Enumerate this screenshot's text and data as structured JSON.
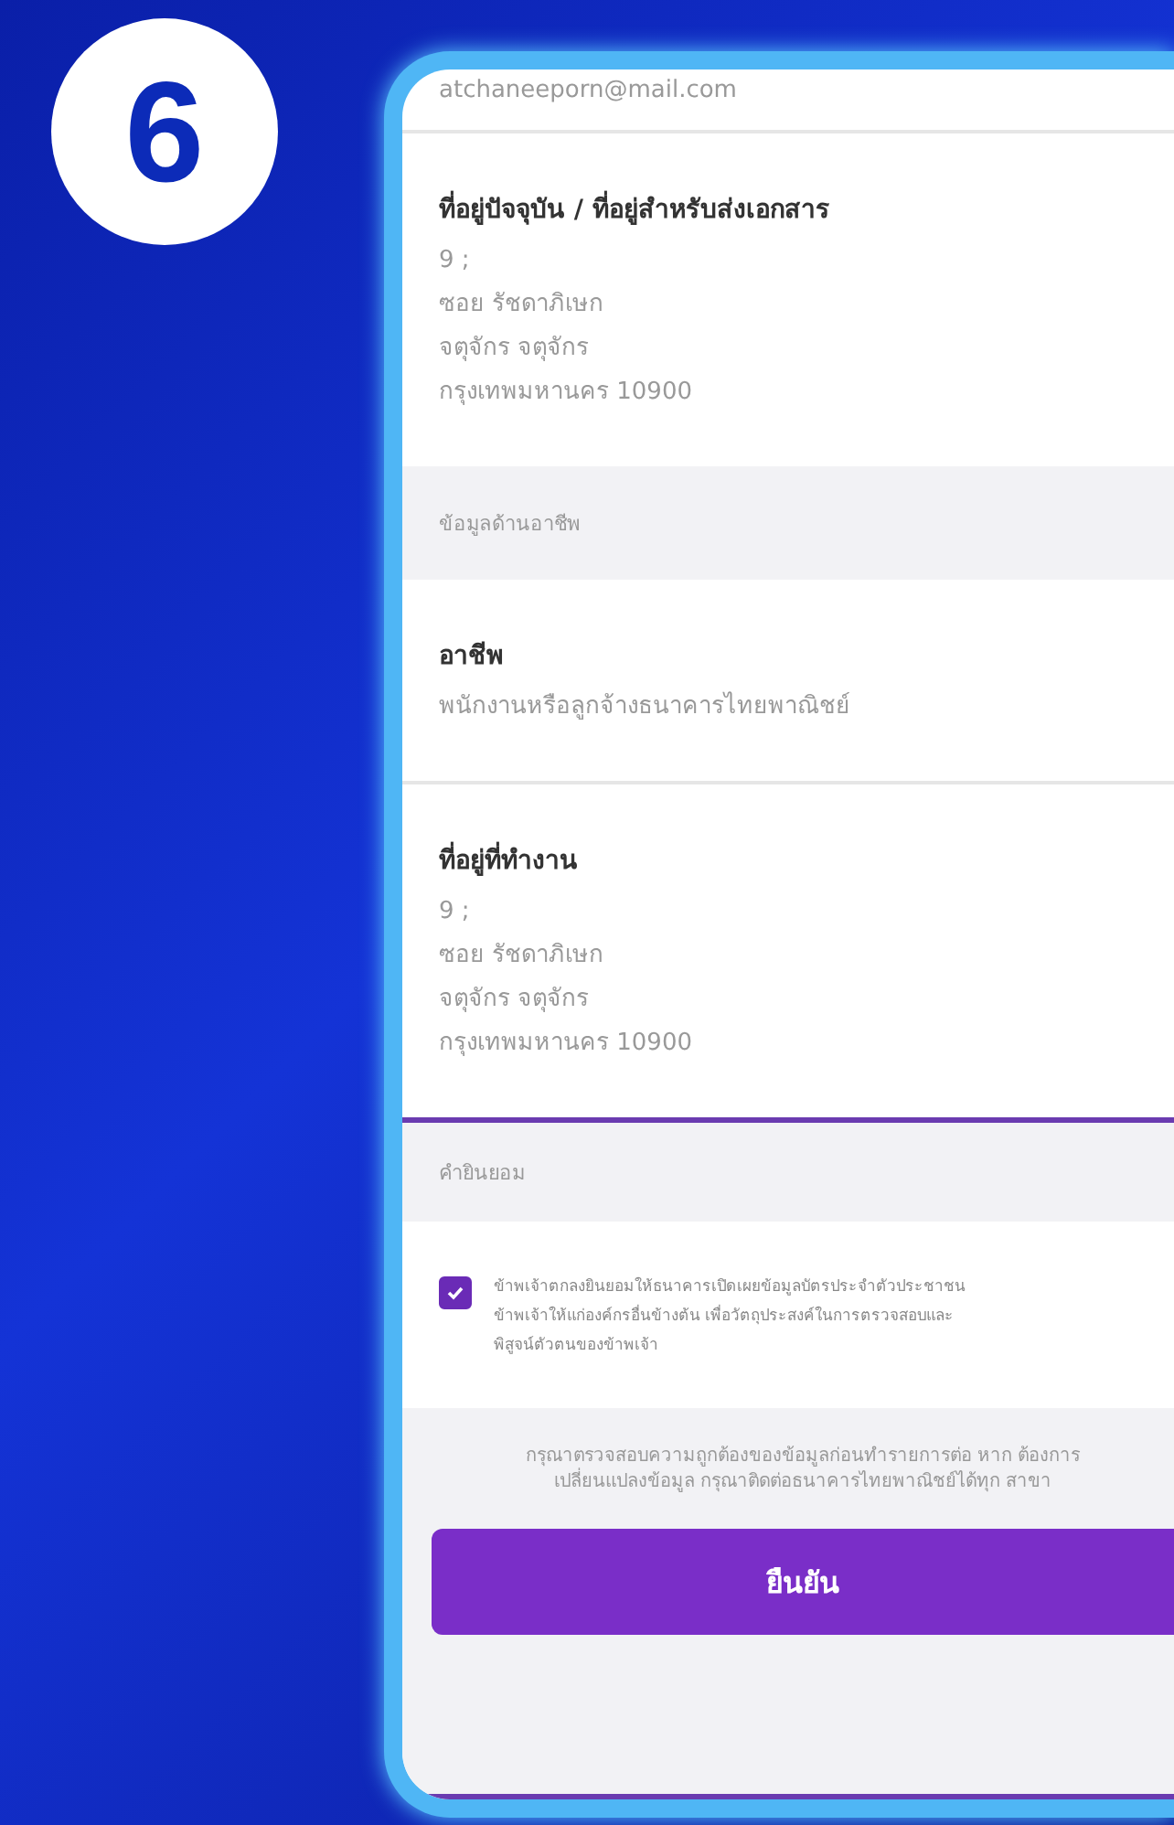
{
  "step_number": "6",
  "email": "atchaneeporn@mail.com",
  "sections": [
    {
      "kind": "field",
      "label": "ที่อยู่ปัจจุบัน / ที่อยู่สำหรับส่งเอกสาร",
      "lines": [
        "9 ;",
        "ซอย รัชดาภิเษก",
        "จตุจักร จตุจักร",
        "กรุงเทพมหานคร 10900"
      ]
    },
    {
      "kind": "header",
      "label": "ข้อมูลด้านอาชีพ"
    },
    {
      "kind": "field",
      "label": "อาชีพ",
      "lines": [
        "พนักงานหรือลูกจ้างธนาคารไทยพาณิชย์"
      ]
    },
    {
      "kind": "field",
      "label": "ที่อยู่ที่ทำงาน",
      "lines": [
        "9 ;",
        "ซอย รัชดาภิเษก",
        "จตุจักร จตุจักร",
        "กรุงเทพมหานคร 10900"
      ]
    },
    {
      "kind": "header",
      "label": "คำยินยอม"
    }
  ],
  "consent": {
    "checked": true,
    "lines": [
      "ข้าพเจ้าตกลงยินยอมให้ธนาคารเปิดเผยข้อมูลบัตรประจำตัวประชาชน",
      "ข้าพเจ้าให้แก่องค์กรอื่นข้างต้น เพื่อวัตถุประสงค์ในการตรวจสอบและ",
      "พิสูจน์ตัวตนของข้าพเจ้า"
    ]
  },
  "notice": "กรุณาตรวจสอบความถูกต้องของข้อมูลก่อนทำรายการต่อ หาก ต้องการเปลี่ยนแปลงข้อมูล กรุณาติดต่อธนาคารไทยพาณิชย์ได้ทุก สาขา",
  "confirm_button": "ยืนยัน"
}
